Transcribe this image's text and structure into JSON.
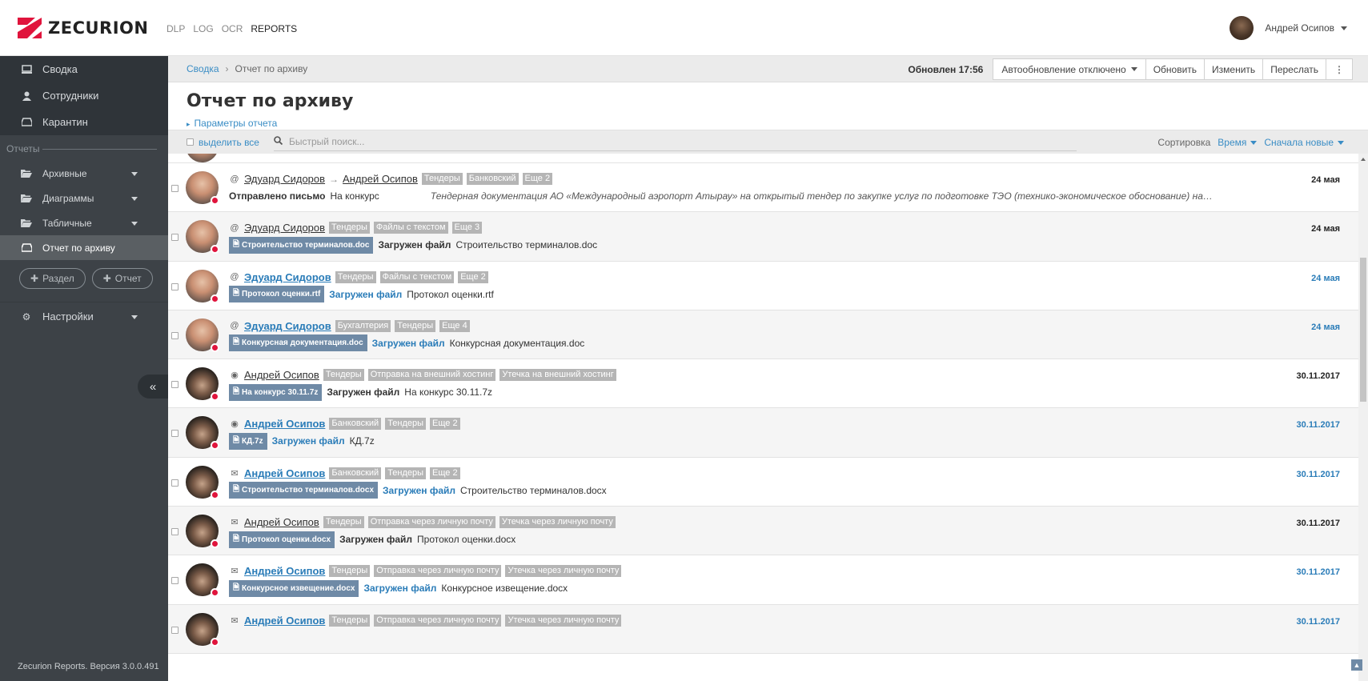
{
  "app": {
    "logo_text": "ZECURION"
  },
  "topnav": [
    "DLP",
    "LOG",
    "OCR",
    "REPORTS"
  ],
  "user": {
    "name": "Андрей Осипов"
  },
  "sidebar": {
    "top": [
      {
        "label": "Сводка",
        "icon": "monitor-icon"
      },
      {
        "label": "Сотрудники",
        "icon": "user-icon"
      },
      {
        "label": "Карантин",
        "icon": "inbox-icon"
      }
    ],
    "section_label": "Отчеты",
    "groups": [
      {
        "label": "Архивные",
        "icon": "folder-icon"
      },
      {
        "label": "Диаграммы",
        "icon": "folder-icon"
      },
      {
        "label": "Табличные",
        "icon": "folder-icon"
      }
    ],
    "active_report": "Отчет по архиву",
    "btn_section": "Раздел",
    "btn_report": "Отчет",
    "settings": "Настройки",
    "version": "Zecurion Reports. Версия 3.0.0.491"
  },
  "breadcrumb": {
    "home": "Сводка",
    "current": "Отчет по архиву"
  },
  "header": {
    "updated": "Обновлен 17:56",
    "autorefresh": "Автообновление отключено",
    "refresh": "Обновить",
    "edit": "Изменить",
    "forward": "Переслать",
    "title": "Отчет по архиву",
    "params": "Параметры отчета"
  },
  "toolbar": {
    "select_all": "выделить все",
    "search_placeholder": "Быстрый поиск...",
    "sort_label": "Сортировка",
    "sort_field": "Время",
    "sort_order": "Сначала новые"
  },
  "rows": [
    {
      "avatar": "ed",
      "channel": "@",
      "from": "Эдуард Сидоров",
      "to": "Андрей Осипов",
      "bold": false,
      "tags": [
        "Тендеры",
        "Банковский",
        "Еще 2"
      ],
      "file": "",
      "action": "Отправлено письмо",
      "action_text": "На конкурс",
      "quote": "Тендерная документация АО «Международный аэропорт Атырау»  на открытый   тендер  по закупке услуг  по  подготовке ТЭО (технико-экономическое обоснование) на строительство гру...",
      "date": "24 мая",
      "highlight": false
    },
    {
      "avatar": "ed",
      "channel": "@",
      "from": "Эдуард Сидоров",
      "to": "",
      "bold": false,
      "tags": [
        "Тендеры",
        "Файлы с текстом",
        "Еще 3"
      ],
      "file": "Строительство терминалов.doc",
      "action": "Загружен файл",
      "action_text": "Строительство терминалов.doc",
      "quote": "",
      "date": "24 мая",
      "highlight": false
    },
    {
      "avatar": "ed",
      "channel": "@",
      "from": "Эдуард Сидоров",
      "to": "",
      "bold": true,
      "tags": [
        "Тендеры",
        "Файлы с текстом",
        "Еще 2"
      ],
      "file": "Протокол оценки.rtf",
      "action": "Загружен файл",
      "action_text": "Протокол оценки.rtf",
      "quote": "",
      "date": "24 мая",
      "highlight": true
    },
    {
      "avatar": "ed",
      "channel": "@",
      "from": "Эдуард Сидоров",
      "to": "",
      "bold": true,
      "tags": [
        "Бухгалтерия",
        "Тендеры",
        "Еще 4"
      ],
      "file": "Конкурсная документация.doc",
      "action": "Загружен файл",
      "action_text": "Конкурсная документация.doc",
      "quote": "",
      "date": "24 мая",
      "highlight": true
    },
    {
      "avatar": "an",
      "channel": "◉",
      "from": "Андрей Осипов",
      "to": "",
      "bold": false,
      "tags": [
        "Тендеры",
        "Отправка на внешний хостинг",
        "Утечка на внешний хостинг"
      ],
      "file": "На конкурс 30.11.7z",
      "action": "Загружен файл",
      "action_text": "На конкурс 30.11.7z",
      "quote": "",
      "date": "30.11.2017",
      "highlight": false
    },
    {
      "avatar": "an",
      "channel": "◉",
      "from": "Андрей Осипов",
      "to": "",
      "bold": true,
      "tags": [
        "Банковский",
        "Тендеры",
        "Еще 2"
      ],
      "file": "КД.7z",
      "action": "Загружен файл",
      "action_text": "КД.7z",
      "quote": "",
      "date": "30.11.2017",
      "highlight": true
    },
    {
      "avatar": "an",
      "channel": "✉",
      "from": "Андрей Осипов",
      "to": "",
      "bold": true,
      "tags": [
        "Банковский",
        "Тендеры",
        "Еще 2"
      ],
      "file": "Строительство терминалов.docx",
      "action": "Загружен файл",
      "action_text": "Строительство терминалов.docx",
      "quote": "",
      "date": "30.11.2017",
      "highlight": true
    },
    {
      "avatar": "an",
      "channel": "✉",
      "from": "Андрей Осипов",
      "to": "",
      "bold": false,
      "tags": [
        "Тендеры",
        "Отправка через личную почту",
        "Утечка через личную почту"
      ],
      "file": "Протокол оценки.docx",
      "action": "Загружен файл",
      "action_text": "Протокол оценки.docx",
      "quote": "",
      "date": "30.11.2017",
      "highlight": false
    },
    {
      "avatar": "an",
      "channel": "✉",
      "from": "Андрей Осипов",
      "to": "",
      "bold": true,
      "tags": [
        "Тендеры",
        "Отправка через личную почту",
        "Утечка через личную почту"
      ],
      "file": "Конкурсное извещение.docx",
      "action": "Загружен файл",
      "action_text": "Конкурсное извещение.docx",
      "quote": "",
      "date": "30.11.2017",
      "highlight": true
    },
    {
      "avatar": "an",
      "channel": "✉",
      "from": "Андрей Осипов",
      "to": "",
      "bold": true,
      "tags": [
        "Тендеры",
        "Отправка через личную почту",
        "Утечка через личную почту"
      ],
      "file": "",
      "action": "",
      "action_text": "",
      "quote": "",
      "date": "30.11.2017",
      "highlight": true
    }
  ],
  "colors": {
    "accent": "#3a8dc5",
    "sidebar": "#3d4247",
    "alert": "#e0143c",
    "logo": "#e0143c"
  }
}
